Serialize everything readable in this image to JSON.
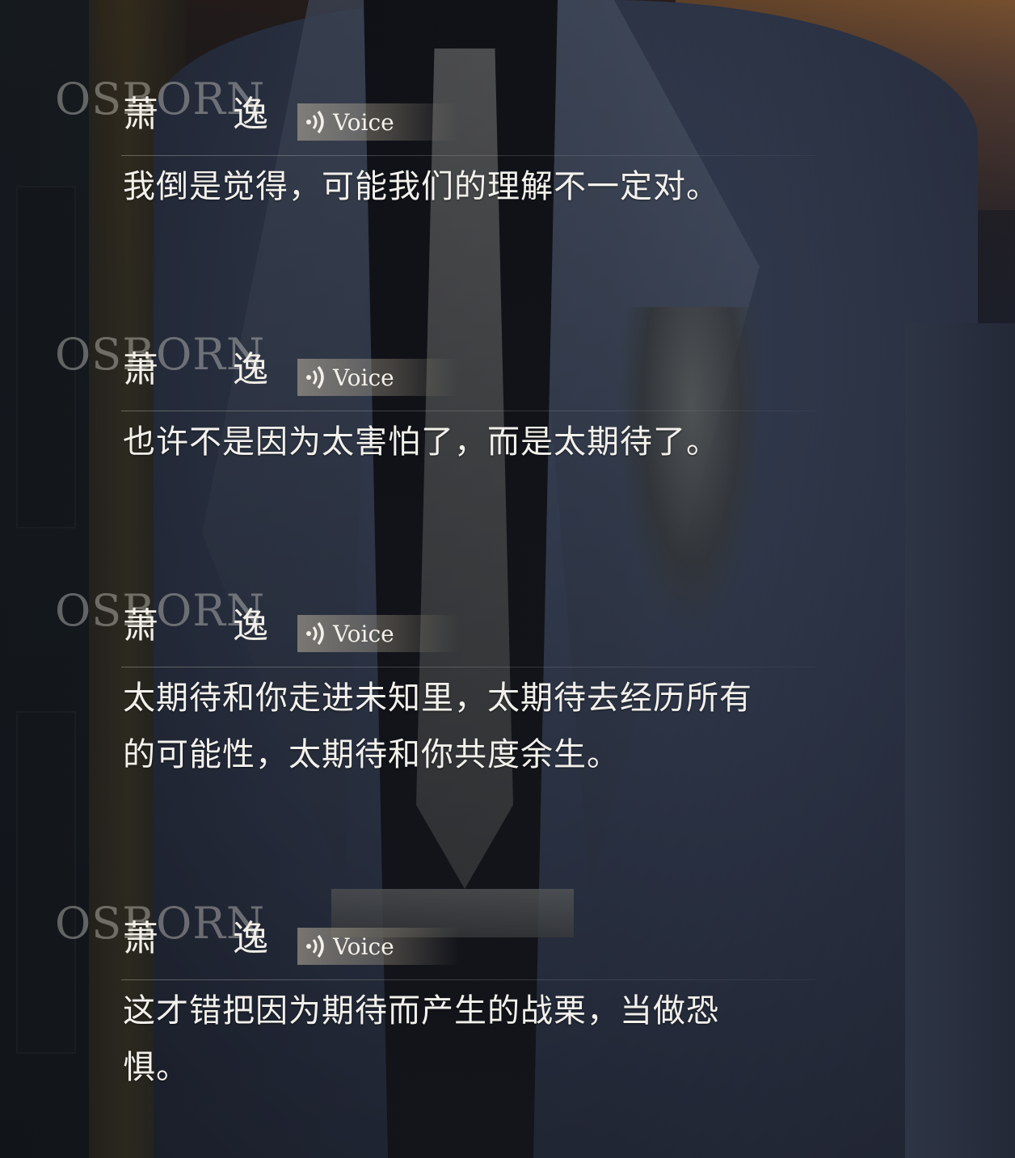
{
  "watermark": "OSBORN",
  "voice_label": "Voice",
  "icons": {
    "voice": "speaker-wave-icon"
  },
  "colors": {
    "text": "#f3f1ec",
    "voice_bg": "#bfb4a0"
  },
  "entries": [
    {
      "speaker": "萧逸",
      "text": "我倒是觉得，可能我们的理解不一定对。"
    },
    {
      "speaker": "萧逸",
      "text": "也许不是因为太害怕了，而是太期待了。"
    },
    {
      "speaker": "萧逸",
      "text": "太期待和你走进未知里，太期待去经历所有的可能性，太期待和你共度余生。"
    },
    {
      "speaker": "萧逸",
      "text": "这才错把因为期待而产生的战栗，当做恐惧。"
    }
  ]
}
